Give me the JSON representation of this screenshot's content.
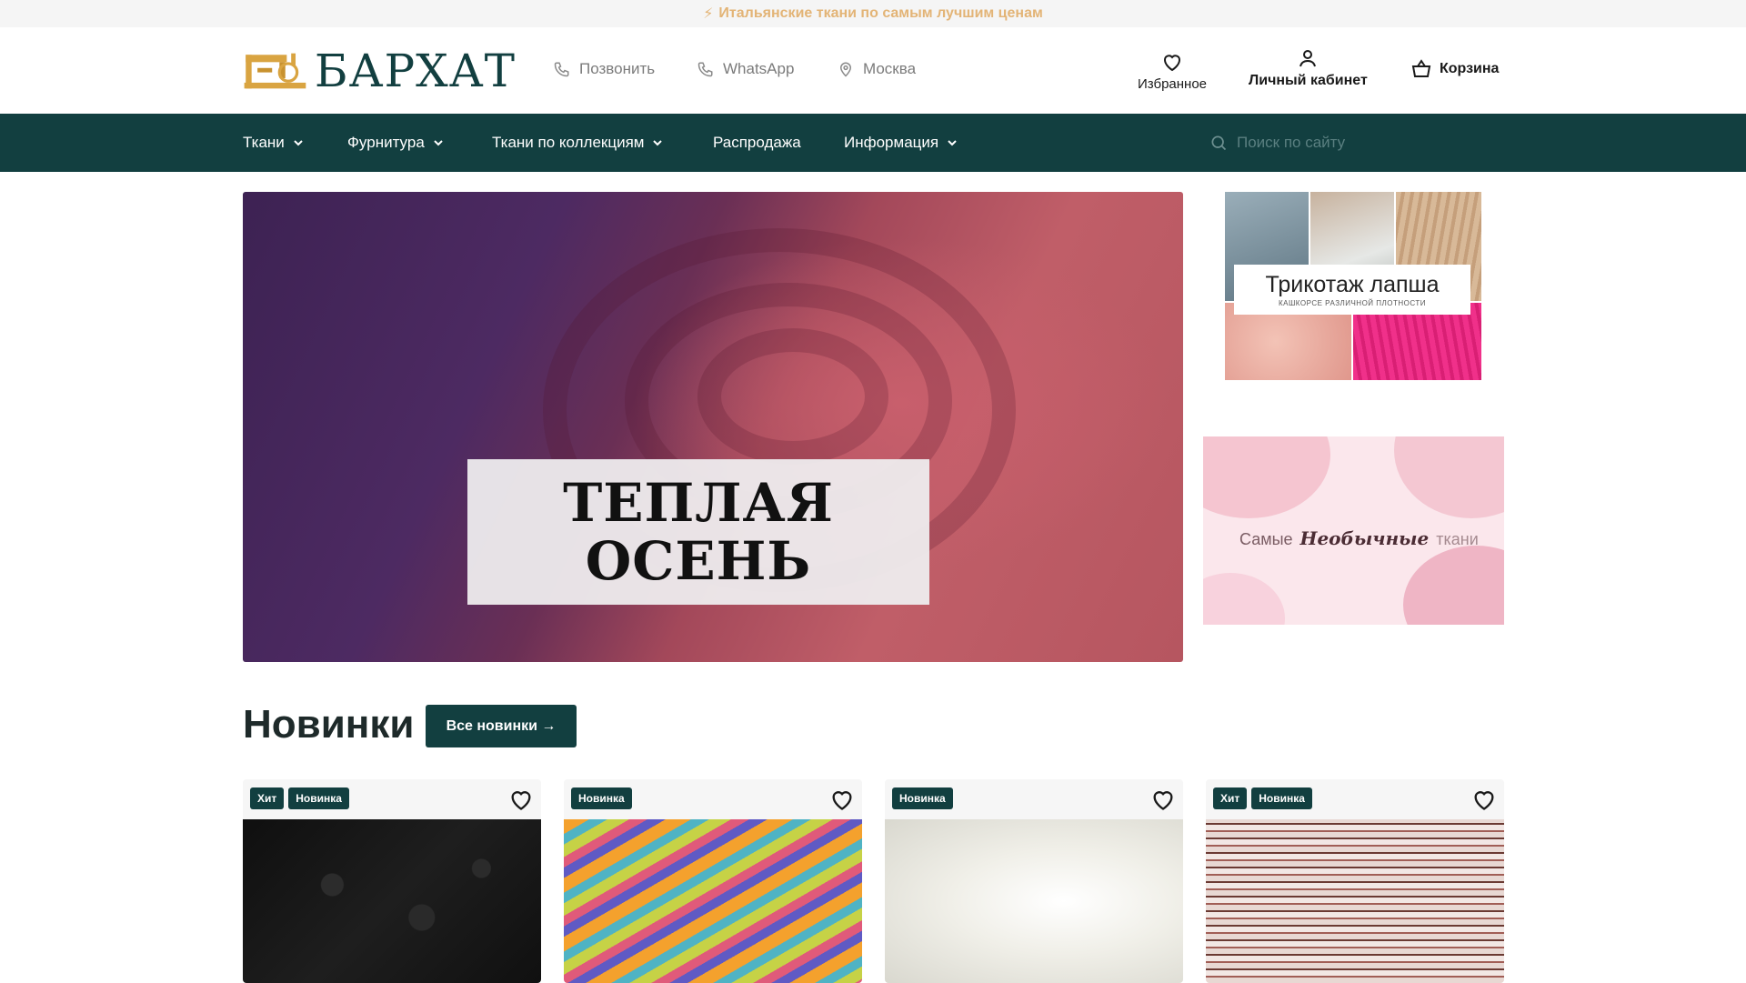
{
  "topbar": {
    "text": "Итальянские ткани по самым лучшим ценам",
    "icon": "lightning-icon"
  },
  "header": {
    "logo_text": "БАРХАТ",
    "call_label": "Позвонить",
    "whatsapp_label": "WhatsApp",
    "city_label": "Москва",
    "favorites_label": "Избранное",
    "account_label": "Личный кабинет",
    "cart_label": "Корзина"
  },
  "nav": {
    "items": [
      {
        "label": "Ткани",
        "dropdown": true
      },
      {
        "label": "Фурнитура",
        "dropdown": true
      },
      {
        "label": "Ткани по коллекциям",
        "dropdown": true
      },
      {
        "label": "Распродажа",
        "dropdown": false
      },
      {
        "label": "Информация",
        "dropdown": true
      }
    ],
    "search_placeholder": "Поиск по сайту"
  },
  "hero": {
    "line1": "ТЕПЛАЯ",
    "line2": "ОСЕНЬ"
  },
  "side_banners": {
    "banner1_title": "Трикотаж лапша",
    "banner1_subtitle": "КАШКОРСЕ РАЗЛИЧНОЙ ПЛОТНОСТИ",
    "banner2_word1": "Самые",
    "banner2_word2": "Необычные",
    "banner2_word3": "ткани"
  },
  "new_section": {
    "title": "Новинки",
    "all_button": "Все новинки →",
    "cards": [
      {
        "badges": [
          "Хит",
          "Новинка"
        ]
      },
      {
        "badges": [
          "Новинка"
        ]
      },
      {
        "badges": [
          "Новинка"
        ]
      },
      {
        "badges": [
          "Хит",
          "Новинка"
        ]
      }
    ]
  },
  "colors": {
    "brand_dark_teal": "#123f40",
    "accent_gold": "#e3b476",
    "topbar_bg": "#f5f5f5"
  }
}
